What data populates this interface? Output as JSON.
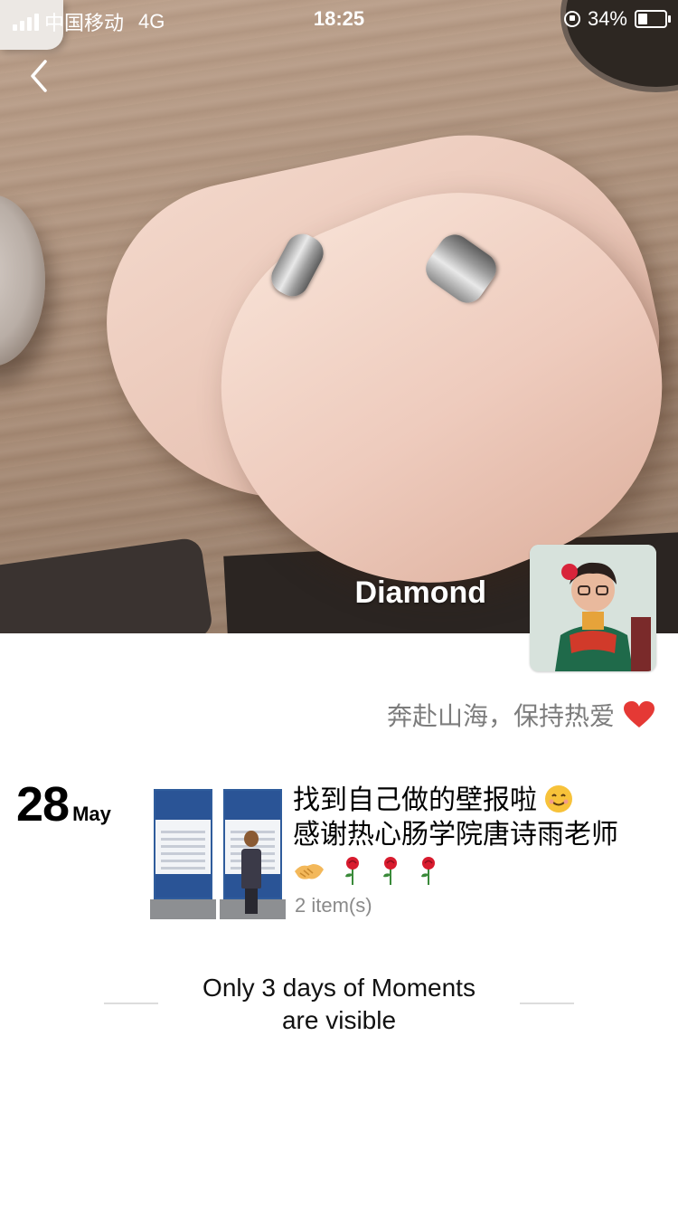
{
  "status_bar": {
    "carrier": "中国移动",
    "network": "4G",
    "time": "18:25",
    "battery_percent": "34%",
    "battery_level": 0.34
  },
  "profile": {
    "name": "Diamond",
    "signature": "奔赴山海，保持热爱",
    "signature_icon": "red-heart-icon"
  },
  "posts": [
    {
      "day": "28",
      "month": "May",
      "text_line1": "找到自己做的壁报啦",
      "text_line2": "感谢热心肠学院唐诗雨老师",
      "emoji_line1": "smiling-face-icon",
      "emoji_line3": [
        "handshake-icon",
        "rose-icon",
        "rose-icon",
        "rose-icon"
      ],
      "item_count": "2 item(s)"
    }
  ],
  "footer": {
    "notice_line1": "Only 3 days of Moments",
    "notice_line2": "are visible"
  },
  "colors": {
    "heart": "#e53935",
    "muted_text": "#7d7d7d",
    "count_text": "#8a8a8a"
  }
}
